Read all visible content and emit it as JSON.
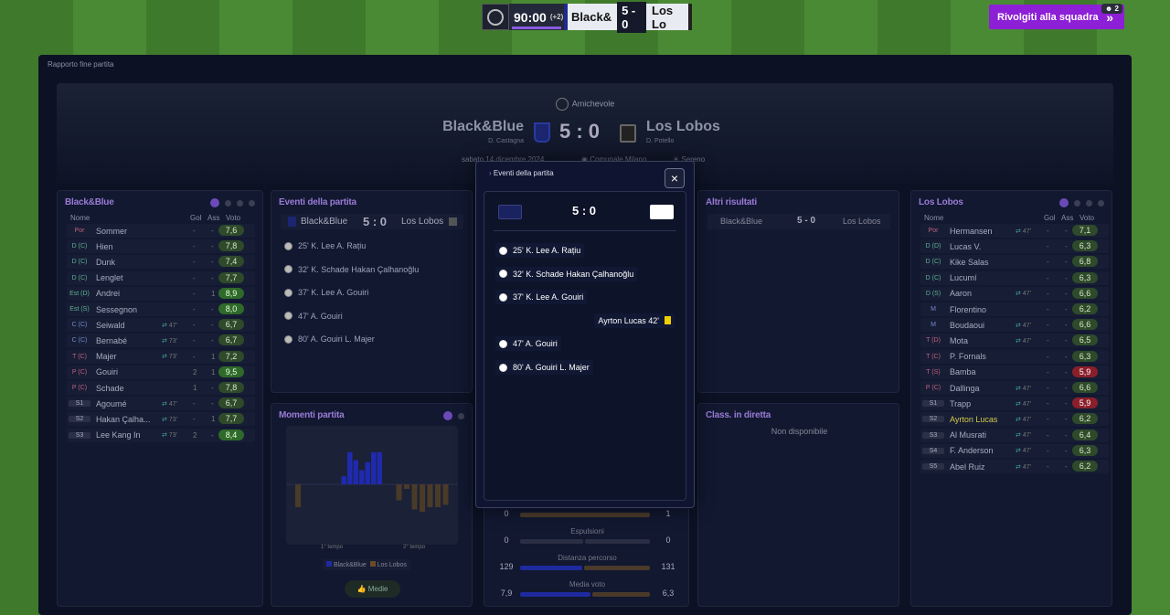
{
  "scorebug": {
    "time": "90:00",
    "added": "(+2)",
    "home": "Black&",
    "score": "5 - 0",
    "away": "Los Lo"
  },
  "back_button": {
    "label": "Rivolgiti alla squadra",
    "badge": "2"
  },
  "window_title": "Rapporto fine partita",
  "header": {
    "competition": "Amichevole",
    "home": "Black&Blue",
    "home_manager": "D. Castagna",
    "away": "Los Lobos",
    "away_manager": "D. Potello",
    "score": "5 : 0",
    "date": "sabato 14 dicembre 2024",
    "venue": "Comunale Milano",
    "weather": "Sereno"
  },
  "home_panel": {
    "title": "Black&Blue",
    "cols": {
      "name": "Nome",
      "goals": "Gol",
      "assists": "Ass",
      "rating": "Voto"
    },
    "players": [
      {
        "pos": "Por",
        "name": "Sommer",
        "sub": "",
        "gol": "-",
        "ass": "-",
        "voto": "7,6"
      },
      {
        "pos": "D (C)",
        "name": "Hien",
        "sub": "",
        "gol": "-",
        "ass": "-",
        "voto": "7,8"
      },
      {
        "pos": "D (C)",
        "name": "Dunk",
        "sub": "",
        "gol": "-",
        "ass": "-",
        "voto": "7,4"
      },
      {
        "pos": "D (C)",
        "name": "Lenglet",
        "sub": "",
        "gol": "-",
        "ass": "-",
        "voto": "7,7"
      },
      {
        "pos": "Est (D)",
        "name": "Andrei",
        "sub": "",
        "gol": "-",
        "ass": "1",
        "voto": "8,9"
      },
      {
        "pos": "Est (S)",
        "name": "Sessegnon",
        "sub": "",
        "gol": "-",
        "ass": "-",
        "voto": "8,0"
      },
      {
        "pos": "C (C)",
        "name": "Seiwald",
        "sub": "47'",
        "gol": "-",
        "ass": "-",
        "voto": "6,7"
      },
      {
        "pos": "C (C)",
        "name": "Bernabé",
        "sub": "73'",
        "gol": "-",
        "ass": "-",
        "voto": "6,7"
      },
      {
        "pos": "T (C)",
        "name": "Majer",
        "sub": "73'",
        "gol": "-",
        "ass": "1",
        "voto": "7,2"
      },
      {
        "pos": "P (C)",
        "name": "Gouiri",
        "sub": "",
        "gol": "2",
        "ass": "1",
        "voto": "9,5"
      },
      {
        "pos": "P (C)",
        "name": "Schade",
        "sub": "",
        "gol": "1",
        "ass": "-",
        "voto": "7,8"
      },
      {
        "pos": "S1",
        "name": "Agoumé",
        "sub": "47'",
        "gol": "-",
        "ass": "-",
        "voto": "6,7"
      },
      {
        "pos": "S2",
        "name": "Hakan Çalha...",
        "sub": "73'",
        "gol": "-",
        "ass": "1",
        "voto": "7,7"
      },
      {
        "pos": "S3",
        "name": "Lee Kang In",
        "sub": "73'",
        "gol": "2",
        "ass": "-",
        "voto": "8,4"
      }
    ]
  },
  "away_panel": {
    "title": "Los Lobos",
    "cols": {
      "name": "Nome",
      "goals": "Gol",
      "assists": "Ass",
      "rating": "Voto"
    },
    "players": [
      {
        "pos": "Por",
        "name": "Hermansen",
        "sub": "47'",
        "gol": "-",
        "ass": "-",
        "voto": "7,1"
      },
      {
        "pos": "D (D)",
        "name": "Lucas V.",
        "sub": "",
        "gol": "-",
        "ass": "-",
        "voto": "6,3"
      },
      {
        "pos": "D (C)",
        "name": "Kike Salas",
        "sub": "",
        "gol": "-",
        "ass": "-",
        "voto": "6,8"
      },
      {
        "pos": "D (C)",
        "name": "Lucumí",
        "sub": "",
        "gol": "-",
        "ass": "-",
        "voto": "6,3"
      },
      {
        "pos": "D (S)",
        "name": "Aaron",
        "sub": "47'",
        "gol": "-",
        "ass": "-",
        "voto": "6,6"
      },
      {
        "pos": "M",
        "name": "Florentino",
        "sub": "",
        "gol": "-",
        "ass": "-",
        "voto": "6,2"
      },
      {
        "pos": "M",
        "name": "Boudaoui",
        "sub": "47'",
        "gol": "-",
        "ass": "-",
        "voto": "6,6"
      },
      {
        "pos": "T (D)",
        "name": "Mota",
        "sub": "47'",
        "gol": "-",
        "ass": "-",
        "voto": "6,5"
      },
      {
        "pos": "T (C)",
        "name": "P. Fornals",
        "sub": "",
        "gol": "-",
        "ass": "-",
        "voto": "6,3"
      },
      {
        "pos": "T (S)",
        "name": "Bamba",
        "sub": "",
        "gol": "-",
        "ass": "-",
        "voto": "5,9"
      },
      {
        "pos": "P (C)",
        "name": "Dallinga",
        "sub": "47'",
        "gol": "-",
        "ass": "-",
        "voto": "6,6"
      },
      {
        "pos": "S1",
        "name": "Trapp",
        "sub": "47'",
        "gol": "-",
        "ass": "-",
        "voto": "5,9"
      },
      {
        "pos": "S2",
        "name": "Ayrton Lucas",
        "sub": "47'",
        "gol": "-",
        "ass": "-",
        "voto": "6,2"
      },
      {
        "pos": "S3",
        "name": "Al Musrati",
        "sub": "47'",
        "gol": "-",
        "ass": "-",
        "voto": "6,4"
      },
      {
        "pos": "S4",
        "name": "F. Anderson",
        "sub": "47'",
        "gol": "-",
        "ass": "-",
        "voto": "6,3"
      },
      {
        "pos": "S5",
        "name": "Abel Ruiz",
        "sub": "47'",
        "gol": "-",
        "ass": "-",
        "voto": "6,2"
      }
    ]
  },
  "events_panel": {
    "title": "Eventi della partita",
    "home": "Black&Blue",
    "score": "5 : 0",
    "away": "Los Lobos",
    "events": [
      "25' K. Lee A. Rațiu",
      "32' K. Schade Hakan Çalhanoğlu",
      "37' K. Lee A. Gouiri",
      "47' A. Gouiri",
      "80' A. Gouiri L. Majer"
    ]
  },
  "momenti_panel": {
    "title": "Momenti partita",
    "half1": "1° tempo",
    "half2": "2° tempo",
    "legend_home": "Black&Blue",
    "legend_away": "Los Lobos",
    "button": "Medie"
  },
  "other_results": {
    "title": "Altri risultati",
    "home": "Black&Blue",
    "score": "5 - 0",
    "away": "Los Lobos"
  },
  "live_table": {
    "title": "Class. in diretta",
    "text": "Non disponibile"
  },
  "stats": [
    {
      "home": "0",
      "away": "1",
      "label": ""
    },
    {
      "home": "0",
      "away": "0",
      "label": "Espulsioni"
    },
    {
      "home": "129",
      "away": "131",
      "label": "Distanza percorso"
    },
    {
      "home": "7,9",
      "away": "6,3",
      "label": "Media voto"
    }
  ],
  "modal": {
    "title": "Eventi della partita",
    "score": "5 : 0",
    "close": "×",
    "events": [
      {
        "text": "25' K. Lee A. Rațiu",
        "side": "home"
      },
      {
        "text": "32' K. Schade Hakan Çalhanoğlu",
        "side": "home"
      },
      {
        "text": "37' K. Lee A. Gouiri",
        "side": "home"
      },
      {
        "text": "Ayrton Lucas 42'",
        "side": "away"
      },
      {
        "text": "47' A. Gouiri",
        "side": "home"
      },
      {
        "text": "80' A. Gouiri L. Majer",
        "side": "home"
      }
    ]
  },
  "chart_data": {
    "type": "bar",
    "series": [
      {
        "values": [
          0,
          0,
          0,
          0,
          0,
          0.2,
          0.8,
          0.6,
          0.35,
          0.55,
          0.8,
          0.8
        ]
      },
      {
        "values": [
          0.5,
          0,
          0,
          0,
          0,
          0,
          0,
          0,
          0,
          0,
          0,
          0,
          0,
          0.35,
          0.1,
          0.55,
          0.6,
          0.5,
          0.5,
          0.45
        ]
      }
    ]
  },
  "colors": {
    "accent": "#8d1fd6",
    "home": "#1f2a8e",
    "away": "#6a4a2a",
    "rating_good": "#2f6a2a",
    "rating_bad": "#8a1f2a"
  }
}
